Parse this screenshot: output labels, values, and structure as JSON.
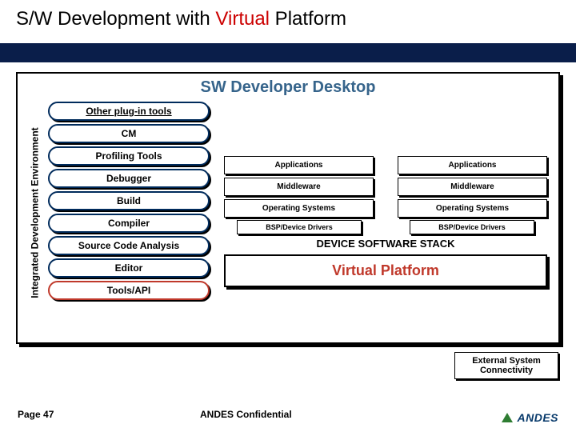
{
  "title": {
    "prefix": "S/W Development with ",
    "highlight": "Virtual",
    "suffix": " Platform"
  },
  "desktop_title": "SW Developer Desktop",
  "ide_label": "Integrated Development Environment",
  "tools": [
    "Other plug-in tools",
    "CM",
    "Profiling Tools",
    "Debugger",
    "Build",
    "Compiler",
    "Source Code Analysis",
    "Editor",
    "Tools/API"
  ],
  "stack": {
    "row1": [
      "Applications",
      "Applications"
    ],
    "row2": [
      "Middleware",
      "Middleware"
    ],
    "row3": [
      "Operating Systems",
      "Operating Systems"
    ],
    "bsp": [
      "BSP/Device Drivers",
      "BSP/Device Drivers"
    ],
    "label": "DEVICE SOFTWARE STACK"
  },
  "virtual_platform": "Virtual Platform",
  "external_box": "External System Connectivity",
  "footer": {
    "page": "Page 47",
    "confidential": "ANDES Confidential",
    "logo_text": "ANDES"
  }
}
